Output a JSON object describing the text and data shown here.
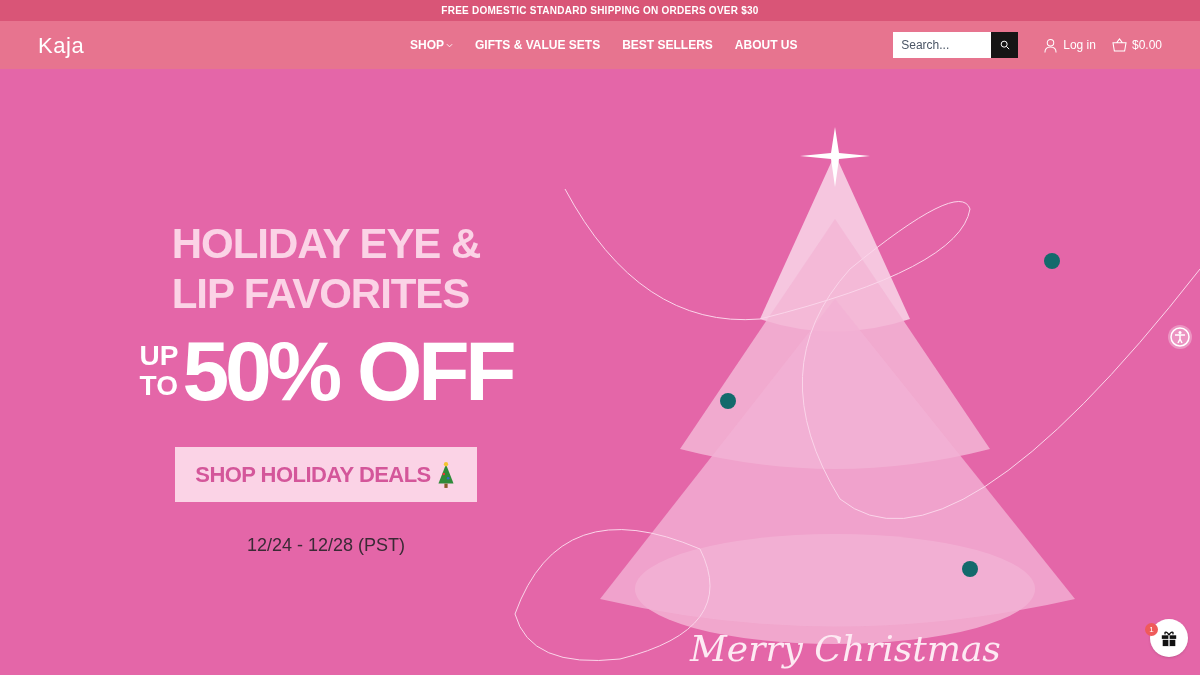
{
  "announcement": "FREE DOMESTIC STANDARD SHIPPING ON ORDERS OVER $30",
  "header": {
    "logo": "Kaja",
    "nav": [
      {
        "label": "SHOP",
        "dropdown": true
      },
      {
        "label": "GIFTS & VALUE SETS",
        "dropdown": false
      },
      {
        "label": "BEST SELLERS",
        "dropdown": false
      },
      {
        "label": "ABOUT US",
        "dropdown": false
      }
    ],
    "search": {
      "placeholder": "Search..."
    },
    "account": "Log in",
    "cart": "$0.00"
  },
  "hero": {
    "headline_lines": [
      "HOLIDAY EYE &",
      "LIP FAVORITES"
    ],
    "prefix_lines": [
      "UP",
      "TO"
    ],
    "discount": "50% OFF",
    "cta": "SHOP HOLIDAY DEALS",
    "dates": "12/24 - 12/28 (PST)",
    "greeting": "Merry Christmas"
  },
  "gift_widget": {
    "badge": "1"
  }
}
